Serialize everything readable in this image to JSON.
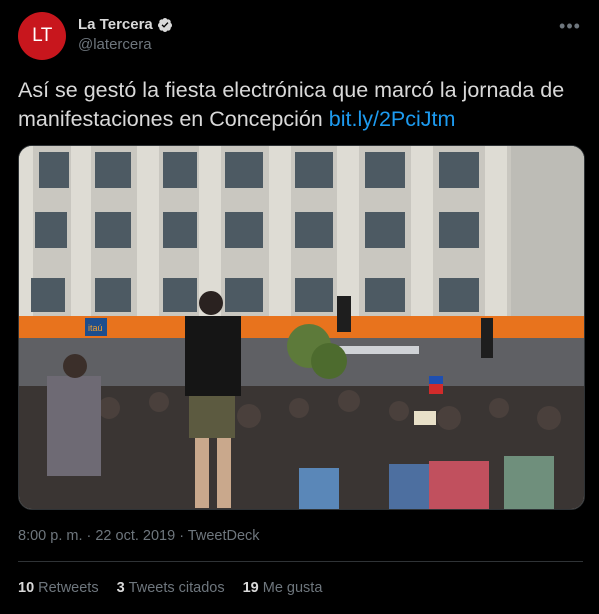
{
  "account": {
    "avatar_text": "LT",
    "avatar_color": "#c8161d",
    "display_name": "La Tercera",
    "handle": "@latercera",
    "verified": true
  },
  "tweet": {
    "text": "Así se gestó la fiesta electrónica que marcó la jornada de manifestaciones en Concepción",
    "link": "bit.ly/2PciJtm",
    "timestamp": "8:00 p. m. · 22 oct. 2019 · TweetDeck"
  },
  "media": {
    "sign_text": "itaú"
  },
  "stats": [
    {
      "count": "10",
      "label": "Retweets"
    },
    {
      "count": "3",
      "label": "Tweets citados"
    },
    {
      "count": "19",
      "label": "Me gusta"
    }
  ],
  "colors": {
    "background": "#000000",
    "link": "#1d9bf0",
    "muted": "#6e767d",
    "divider": "#2f3336"
  }
}
